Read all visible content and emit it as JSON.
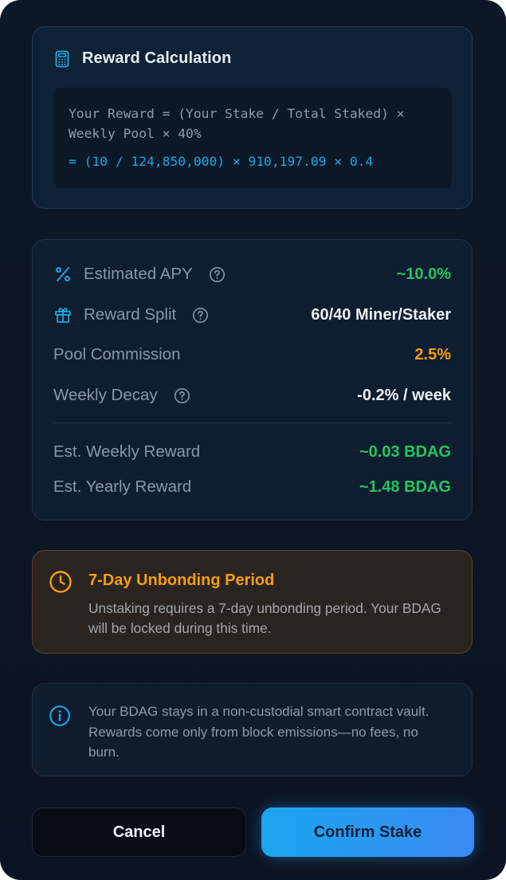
{
  "reward_calc": {
    "title": "Reward Calculation",
    "icon": "calculator-icon",
    "formula_line1": "Your Reward = (Your Stake / Total Staked) ×",
    "formula_line2": "Weekly Pool × 40%",
    "formula_values": "= (10 / 124,850,000) × 910,197.09 × 0.4"
  },
  "stats": {
    "estimated_apy": {
      "label": "Estimated APY",
      "value": "~10.0%",
      "icon": "percent-icon"
    },
    "reward_split": {
      "label": "Reward Split",
      "value": "60/40 Miner/Staker",
      "icon": "gift-icon"
    },
    "pool_commission": {
      "label": "Pool Commission",
      "value": "2.5%"
    },
    "weekly_decay": {
      "label": "Weekly Decay",
      "value": "-0.2% / week"
    },
    "est_weekly_reward": {
      "label": "Est. Weekly Reward",
      "value": "~0.03 BDAG"
    },
    "est_yearly_reward": {
      "label": "Est. Yearly Reward",
      "value": "~1.48 BDAG"
    }
  },
  "unbonding": {
    "title": "7-Day Unbonding Period",
    "description": "Unstaking requires a 7-day unbonding period. Your BDAG will be locked during this time.",
    "icon": "clock-icon"
  },
  "info": {
    "text": "Your BDAG stays in a non-custodial smart contract vault. Rewards come only from block emissions—no fees, no burn.",
    "icon": "info-icon"
  },
  "buttons": {
    "cancel": "Cancel",
    "confirm": "Confirm Stake"
  },
  "colors": {
    "accent_blue": "#1aa7e6",
    "positive_green": "#22c55e",
    "warning_orange": "#f59e0b"
  }
}
